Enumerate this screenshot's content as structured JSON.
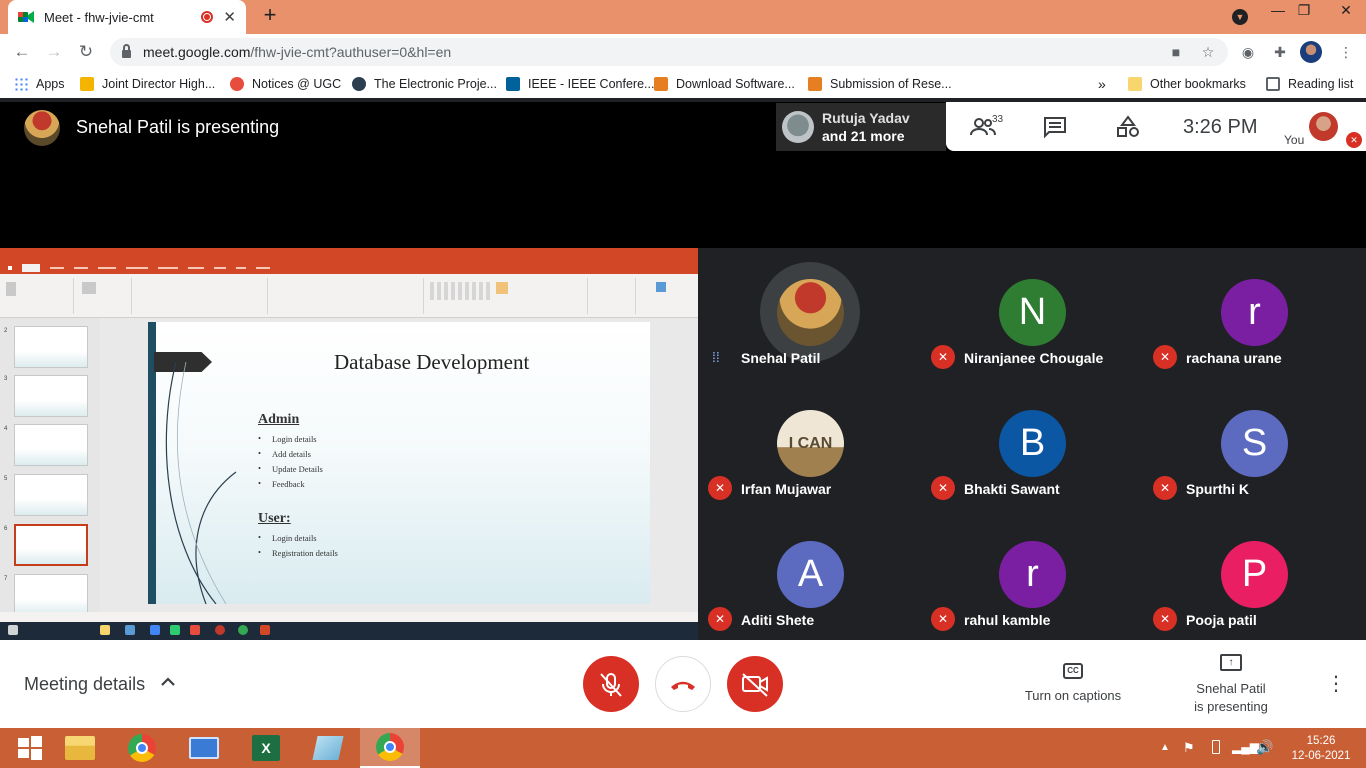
{
  "browser": {
    "tab_title": "Meet - fhw-jvie-cmt",
    "tab_close": "✕",
    "new_tab": "+",
    "url_host": "meet.google.com",
    "url_path": "/fhw-jvie-cmt?authuser=0&hl=en",
    "window_controls": {
      "minimize": "—",
      "restore": "❐",
      "close": "✕"
    }
  },
  "bookmarks": {
    "items": [
      {
        "label": "Apps",
        "color": "#4285f4"
      },
      {
        "label": "Joint Director High...",
        "color": "#f4b400"
      },
      {
        "label": "Notices @ UGC",
        "color": "#e74c3c"
      },
      {
        "label": "The Electronic Proje...",
        "color": "#2c3e50"
      },
      {
        "label": "IEEE - IEEE Confere...",
        "color": "#00629b"
      },
      {
        "label": "Download Software...",
        "color": "#e67e22"
      },
      {
        "label": "Submission of Rese...",
        "color": "#e67e22"
      }
    ],
    "overflow": "»",
    "other_bookmarks": "Other bookmarks",
    "reading_list": "Reading list"
  },
  "meet_top": {
    "presenting_title": "Snehal Patil is presenting",
    "recent_speaker": "Rutuja Yadav",
    "recent_more": "and 21 more",
    "people_count": "33",
    "clock": "3:26  PM",
    "you_label": "You"
  },
  "slide": {
    "title": "Database Development",
    "sections": [
      {
        "heading": "Admin",
        "bullets": [
          "Login details",
          "Add details",
          "Update Details",
          "Feedback"
        ]
      },
      {
        "heading": "User:",
        "bullets": [
          "Login details",
          "Registration details"
        ]
      }
    ],
    "thumb_numbers": [
      "2",
      "3",
      "4",
      "5",
      "6",
      "7"
    ]
  },
  "participants": [
    {
      "name": "Snehal Patil",
      "initial": "",
      "color": "#c0392b",
      "muted": false
    },
    {
      "name": "Niranjanee Chougale",
      "initial": "N",
      "color": "#2e7d32",
      "muted": true
    },
    {
      "name": "rachana urane",
      "initial": "r",
      "color": "#7b1fa2",
      "muted": true
    },
    {
      "name": "Irfan Mujawar",
      "initial": "",
      "color": "#c9b79c",
      "muted": true
    },
    {
      "name": "Bhakti Sawant",
      "initial": "B",
      "color": "#0b57a4",
      "muted": true
    },
    {
      "name": "Spurthi K",
      "initial": "S",
      "color": "#5c6bc0",
      "muted": true
    },
    {
      "name": "Aditi Shete",
      "initial": "A",
      "color": "#5c6bc0",
      "muted": true
    },
    {
      "name": "rahul kamble",
      "initial": "r",
      "color": "#7b1fa2",
      "muted": true
    },
    {
      "name": "Pooja patil",
      "initial": "P",
      "color": "#e91e63",
      "muted": true
    }
  ],
  "avatar_text": {
    "irfan": "I CAN"
  },
  "bottom_bar": {
    "meeting_details": "Meeting details",
    "captions_icon": "CC",
    "captions_label": "Turn on captions",
    "present_label_1": "Snehal Patil",
    "present_label_2": "is presenting",
    "accent_red": "#d93025"
  },
  "taskbar": {
    "time": "15:26",
    "date": "12-06-2021"
  }
}
